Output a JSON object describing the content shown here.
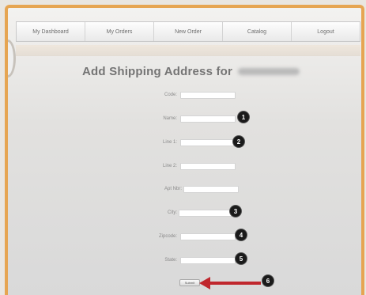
{
  "nav": {
    "items": [
      "My Dashboard",
      "My Orders",
      "New Order",
      "Catalog",
      "Logout"
    ]
  },
  "page": {
    "title": "Add Shipping Address for"
  },
  "form": {
    "fields": [
      {
        "label": "Code:",
        "value": ""
      },
      {
        "label": "Name:",
        "value": ""
      },
      {
        "label": "Line 1:",
        "value": ""
      },
      {
        "label": "Line 2:",
        "value": ""
      },
      {
        "label": "Apt Nbr:",
        "value": ""
      },
      {
        "label": "City:",
        "value": ""
      },
      {
        "label": "Zipcode:",
        "value": ""
      },
      {
        "label": "State:",
        "value": ""
      }
    ],
    "submit_label": "Submit"
  },
  "callouts": [
    "1",
    "2",
    "3",
    "4",
    "5",
    "6"
  ],
  "colors": {
    "frame": "#e6a552",
    "badge": "#1a1a1a",
    "arrow": "#c0272d"
  }
}
